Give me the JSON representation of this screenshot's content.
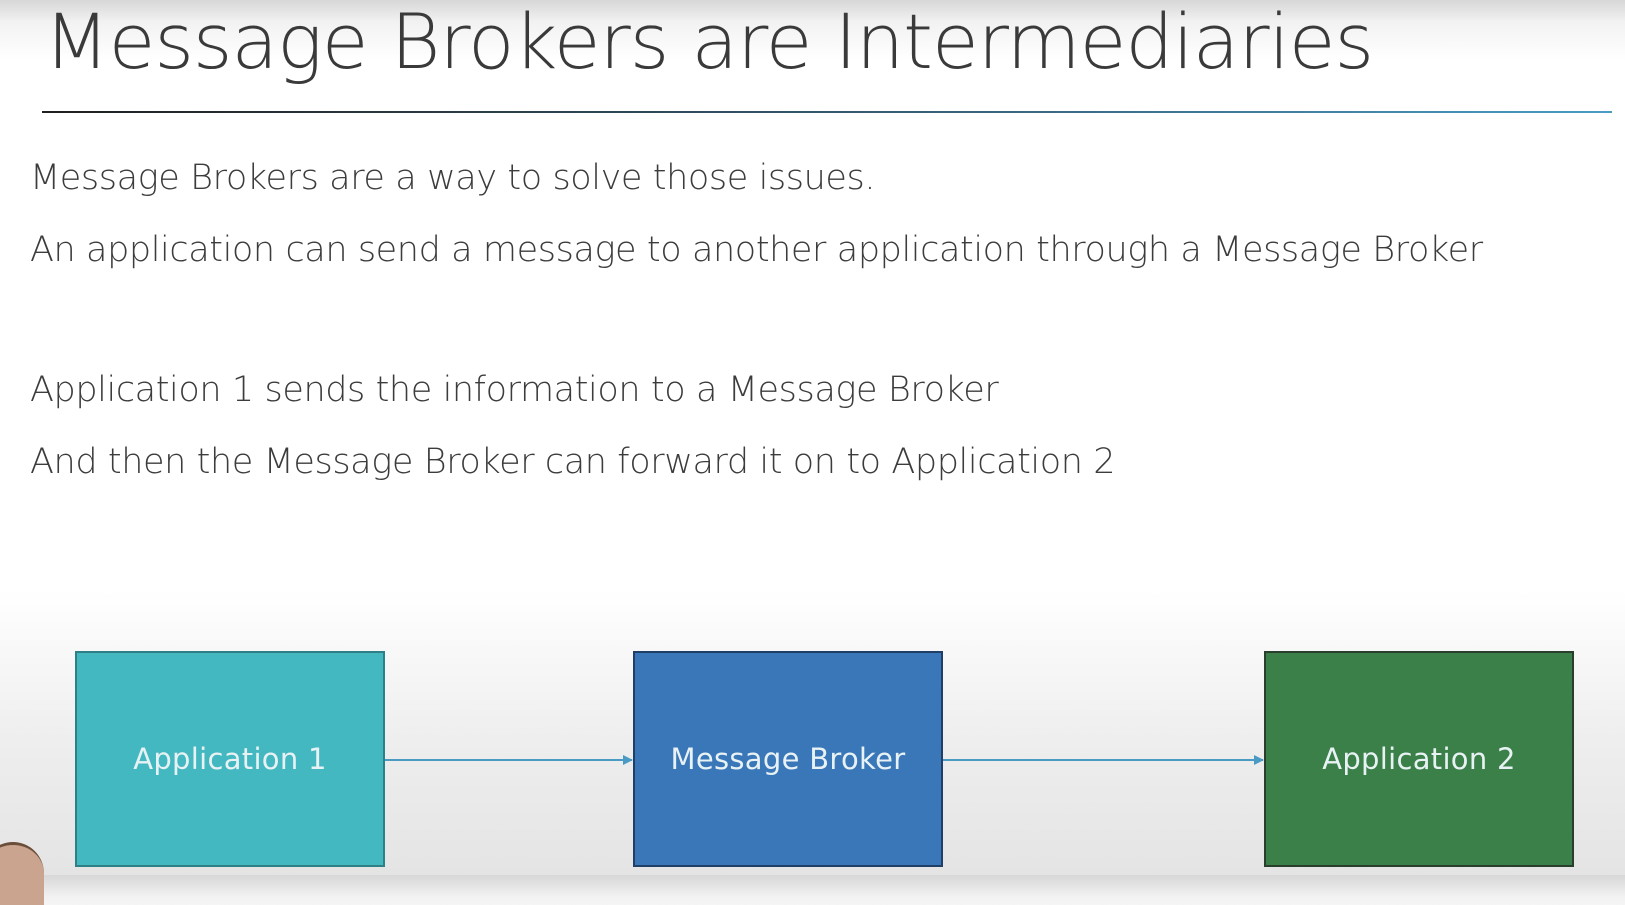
{
  "slide": {
    "title": "Message Brokers are Intermediaries",
    "bullets": [
      "Message Brokers are a way to solve those issues.",
      "An application can send a message to another application through a Message Broker",
      "Application 1 sends the information to a Message Broker",
      "And then the Message Broker can forward it on to Application 2"
    ]
  },
  "diagram": {
    "nodes": [
      {
        "id": "app1",
        "label": "Application 1",
        "color": "#44b8c0"
      },
      {
        "id": "broker",
        "label": "Message Broker",
        "color": "#3a77b8"
      },
      {
        "id": "app2",
        "label": "Application 2",
        "color": "#3a8048"
      }
    ],
    "edges": [
      {
        "from": "app1",
        "to": "broker"
      },
      {
        "from": "broker",
        "to": "app2"
      }
    ],
    "arrow_color": "#4a9bc4"
  }
}
